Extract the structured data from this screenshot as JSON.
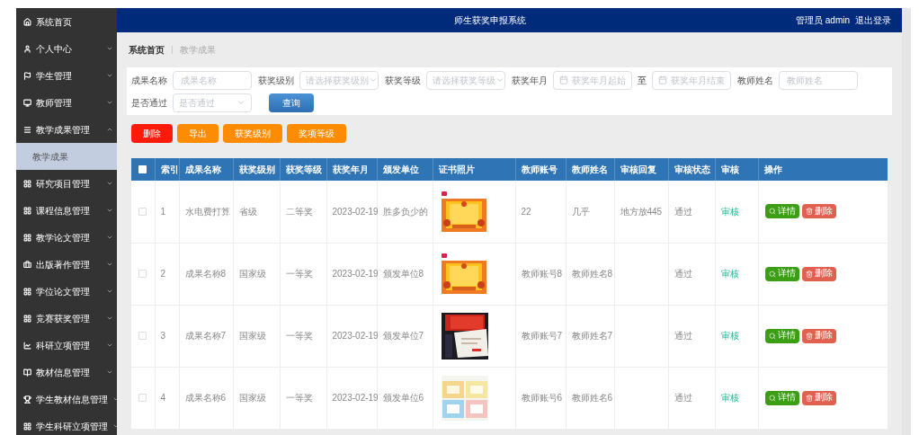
{
  "header": {
    "title": "师生获奖申报系统",
    "user": "管理员 admin",
    "logout": "退出登录"
  },
  "sidebar": {
    "items": [
      {
        "label": "系统首页"
      },
      {
        "label": "个人中心",
        "expanded": false
      },
      {
        "label": "学生管理",
        "expanded": false
      },
      {
        "label": "教师管理",
        "expanded": false
      },
      {
        "label": "教学成果管理",
        "expanded": true,
        "children": [
          {
            "label": "教学成果",
            "selected": true
          }
        ]
      },
      {
        "label": "研究项目管理",
        "expanded": false
      },
      {
        "label": "课程信息管理",
        "expanded": false
      },
      {
        "label": "教学论文管理",
        "expanded": false
      },
      {
        "label": "出版著作管理",
        "expanded": false
      },
      {
        "label": "学位论文管理",
        "expanded": false
      },
      {
        "label": "竞赛获奖管理",
        "expanded": false
      },
      {
        "label": "科研立项管理",
        "expanded": false
      },
      {
        "label": "教材信息管理",
        "expanded": false
      },
      {
        "label": "学生教材信息管理",
        "expanded": false
      },
      {
        "label": "学生科研立项管理",
        "expanded": false
      }
    ]
  },
  "breadcrumb": [
    "系统首页",
    "教学成果"
  ],
  "filter_rows": [
    [
      {
        "kind": "input",
        "label": "成果名称",
        "placeholder": "成果名称"
      },
      {
        "kind": "select",
        "label": "获奖级别",
        "placeholder": "请选择获奖级别"
      },
      {
        "kind": "select",
        "label": "获奖等级",
        "placeholder": "请选择获奖等级"
      },
      {
        "kind": "date_range",
        "label": "获奖年月",
        "start_placeholder": "获奖年月起始",
        "separator": "至",
        "end_placeholder": "获奖年月结束"
      },
      {
        "kind": "input",
        "label": "教师姓名",
        "placeholder": "教师姓名"
      }
    ],
    [
      {
        "kind": "select",
        "label": "是否通过",
        "placeholder": "是否通过"
      },
      {
        "kind": "button",
        "label": "查询"
      }
    ]
  ],
  "toolbar": [
    {
      "label": "删除",
      "kind": "danger"
    },
    {
      "label": "导出",
      "kind": "warning"
    },
    {
      "label": "获奖级别",
      "kind": "warning"
    },
    {
      "label": "奖项等级",
      "kind": "warning"
    }
  ],
  "table": {
    "header_checked": false,
    "columns": [
      "索引",
      "成果名称",
      "获奖级别",
      "获奖等级",
      "获奖年月",
      "颁发单位",
      "证书照片",
      "教师账号",
      "教师姓名",
      "审核回复",
      "审核状态",
      "审核",
      "操作"
    ],
    "rows": [
      {
        "checked": false,
        "index": "1",
        "name": "水电费打算",
        "level": "省级",
        "grade": "二等奖",
        "date": "2023-02-19",
        "issuer": "胜多负少的",
        "photo": {
          "kind": "picture",
          "badge": true
        },
        "account": "22",
        "teacher": "几乎",
        "reply": "地方放445",
        "status": "通过",
        "audit": "审核",
        "actions": [
          "详情",
          "删除"
        ]
      },
      {
        "checked": false,
        "index": "2",
        "name": "成果名称8",
        "level": "国家级",
        "grade": "一等奖",
        "date": "2023-02-19",
        "issuer": "颁发单位8",
        "photo": {
          "kind": "picture",
          "badge": true
        },
        "account": "教师账号8",
        "teacher": "教师姓名8",
        "status": "通过",
        "audit": "审核",
        "actions": [
          "详情",
          "删除"
        ]
      },
      {
        "checked": false,
        "index": "3",
        "name": "成果名称7",
        "level": "国家级",
        "grade": "一等奖",
        "date": "2023-02-19",
        "issuer": "颁发单位7",
        "photo": {
          "kind": "picture",
          "badge": false
        },
        "account": "教师账号7",
        "teacher": "教师姓名7",
        "status": "通过",
        "audit": "审核",
        "actions": [
          "详情",
          "删除"
        ]
      },
      {
        "checked": false,
        "index": "4",
        "name": "成果名称6",
        "level": "国家级",
        "grade": "一等奖",
        "date": "2023-02-19",
        "issuer": "颁发单位6",
        "photo": {
          "kind": "picture",
          "badge": false
        },
        "account": "教师账号6",
        "teacher": "教师姓名6",
        "status": "通过",
        "audit": "审核",
        "actions": [
          "详情",
          "删除"
        ]
      }
    ]
  }
}
